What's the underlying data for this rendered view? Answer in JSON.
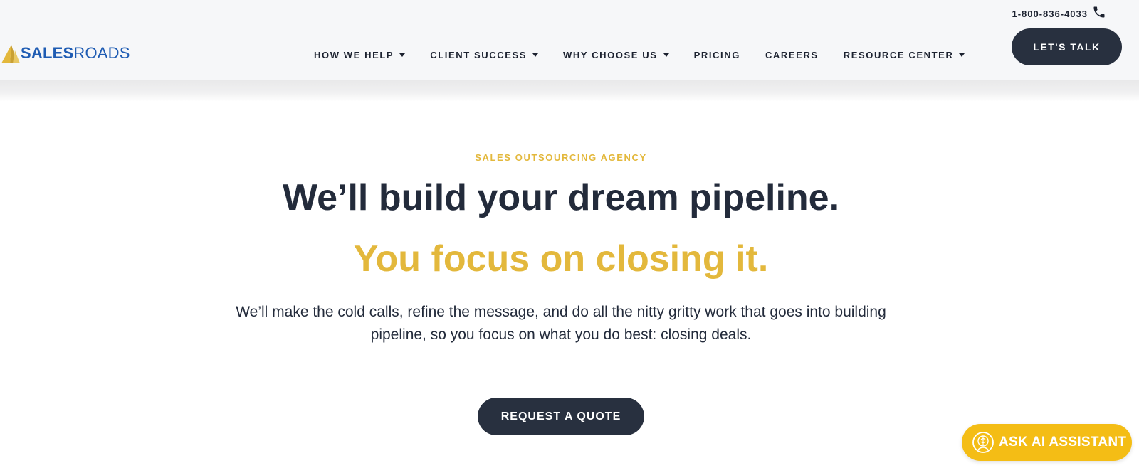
{
  "brand": {
    "logo_sales": "SALES",
    "logo_roads": "ROADS",
    "logo_icon": "sail-logo-icon"
  },
  "header": {
    "phone": "1-800-836-4033",
    "phone_icon": "phone-icon",
    "cta_label": "LET'S TALK"
  },
  "nav": {
    "items": [
      {
        "label": "HOW WE HELP",
        "has_dropdown": true
      },
      {
        "label": "CLIENT SUCCESS",
        "has_dropdown": true
      },
      {
        "label": "WHY CHOOSE US",
        "has_dropdown": true
      },
      {
        "label": "PRICING",
        "has_dropdown": false
      },
      {
        "label": "CAREERS",
        "has_dropdown": false
      },
      {
        "label": "RESOURCE CENTER",
        "has_dropdown": true
      }
    ]
  },
  "hero": {
    "eyebrow": "SALES OUTSOURCING AGENCY",
    "headline": "We’ll build your dream pipeline.",
    "subheadline": "You focus on closing it.",
    "body": "We’ll make the cold calls, refine the message, and do all the nitty gritty work that goes into building pipeline, so you focus on what you do best: closing deals.",
    "cta_label": "REQUEST A QUOTE"
  },
  "assistant": {
    "label": "ASK AI ASSISTANT",
    "icon": "ai-assistant-icon"
  },
  "colors": {
    "navy": "#28303f",
    "gold": "#e3b83c",
    "assistant_yellow": "#f4bd15",
    "brand_blue": "#1f5cb3"
  }
}
